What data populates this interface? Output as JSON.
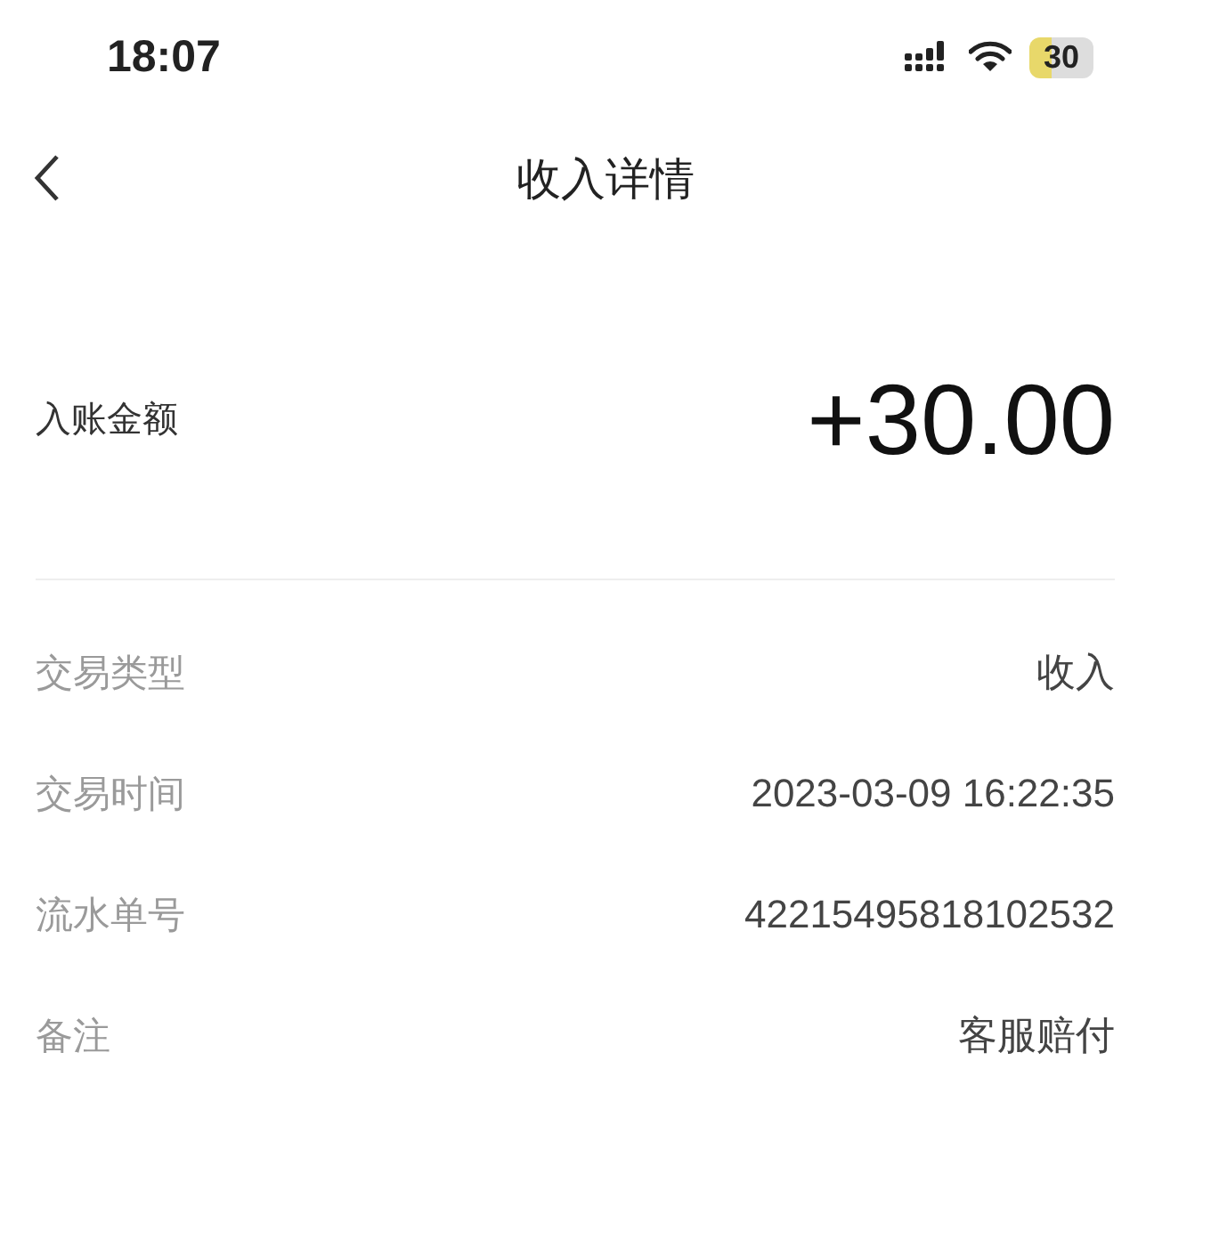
{
  "status_bar": {
    "time": "18:07",
    "battery": "30"
  },
  "nav": {
    "title": "收入详情"
  },
  "amount": {
    "label": "入账金额",
    "value": "+30.00"
  },
  "details": [
    {
      "label": "交易类型",
      "value": "收入"
    },
    {
      "label": "交易时间",
      "value": "2023-03-09 16:22:35"
    },
    {
      "label": "流水单号",
      "value": "42215495818102532"
    },
    {
      "label": "备注",
      "value": "客服赔付"
    }
  ]
}
